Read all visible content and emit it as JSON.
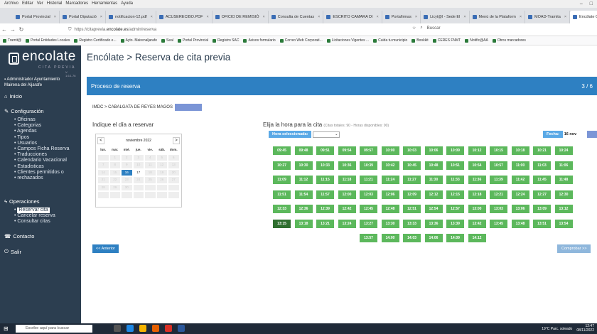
{
  "browser": {
    "menu": [
      "Archivo",
      "Editar",
      "Ver",
      "Historial",
      "Marcadores",
      "Herramientas",
      "Ayuda"
    ],
    "tabs": [
      {
        "label": "Portal Provincial"
      },
      {
        "label": "Portal Diputació"
      },
      {
        "label": "notificacion-12.pdf"
      },
      {
        "label": "ACUSERECIBO.PDF"
      },
      {
        "label": "OFICIO DE REMISIÓ"
      },
      {
        "label": "Consulta de Cuentas"
      },
      {
        "label": "ESCRITO CAMARA DI"
      },
      {
        "label": "Portafirmas"
      },
      {
        "label": "Licyt@l - Sede El"
      },
      {
        "label": "Menú de la Plataform"
      },
      {
        "label": "MOAD-Tramita"
      },
      {
        "label": "Encólate Cita Pre"
      }
    ],
    "url_prefix": "https://citaprevia.",
    "url_domain": "encolate.es",
    "url_path": "/admin/reserva",
    "search_placeholder": "Buscar",
    "bookmarks": [
      "Tramit@",
      "Portal Entidades Locales",
      "Registro Certificado e...",
      "Ayto. Mairenaljarafe",
      "Seal",
      "Portal Provincial",
      "Registro SAC",
      "Avisos formulario",
      "Correo Web Corporati...",
      "Licitaciones Vigentes ...",
      "Cuida tu municipio",
      "Bookkit",
      "CERES FNMT",
      "Notific@AA",
      "Otros marcadores"
    ]
  },
  "sidebar": {
    "logo": "encolate",
    "logo_sub": "CITA PREVIA",
    "version": "V. 1.6.1.76",
    "user_line1": "Administrador Ayuntamiento",
    "user_line2": "Mairena del Aljarafe",
    "inicio": "Inicio",
    "configuracion": "Configuración",
    "config_items": [
      "Oficinas",
      "Categorias",
      "Agendas",
      "Tipos",
      "Usuarios",
      "Campos Ficha Reserva",
      "Traducciones",
      "Calendario Vacacional",
      "Estadisticas",
      "Clientes permitidos o",
      "rechazados"
    ],
    "operaciones": "Operaciones",
    "oper_items": [
      "Reservar cita",
      "Cancelar reserva",
      "Consultar citas"
    ],
    "contacto": "Contacto",
    "salir": "Salir"
  },
  "main": {
    "title": "Encólate > Reserva de cita previa",
    "process": "Proceso de reserva",
    "step": "3 / 6",
    "breadcrumb": "IMDC > CABALGATA DE REYES MAGOS",
    "cal_heading": "Indique el día a reservar",
    "cal_month": "noviembre 2022",
    "cal_prev": "<",
    "cal_next": ">",
    "weekdays": [
      "lun.",
      "mar.",
      "mié.",
      "jue.",
      "vie.",
      "sáb.",
      "dom."
    ],
    "today": "16",
    "active_day": "17",
    "hour_heading": "Elija la hora para la cita",
    "hour_note": "(Citas totales: 90 - Horas disponibles: 90)",
    "hour_selected_label": "Hora seleccionada:",
    "fecha_label": "Fecha:",
    "fecha_value": "16 nov",
    "back": "<< Anterior",
    "next": "Comprobar >>",
    "chosen_slot": "13:15",
    "slot_rows": [
      [
        "09:45",
        "09:48",
        "09:51",
        "09:54",
        "09:57",
        "10:00",
        "10:03",
        "10:06",
        "10:09",
        "10:12",
        "10:15",
        "10:18",
        "10:21",
        "10:24"
      ],
      [
        "10:27",
        "10:30",
        "10:33",
        "10:36",
        "10:39",
        "10:42",
        "10:45",
        "10:48",
        "10:51",
        "10:54",
        "10:57",
        "11:00",
        "11:03",
        "11:06"
      ],
      [
        "11:09",
        "11:12",
        "11:15",
        "11:18",
        "11:21",
        "11:24",
        "11:27",
        "11:30",
        "11:33",
        "11:36",
        "11:39",
        "11:42",
        "11:45",
        "11:48"
      ],
      [
        "11:51",
        "11:54",
        "11:57",
        "12:00",
        "12:03",
        "12:06",
        "12:09",
        "12:12",
        "12:15",
        "12:18",
        "12:21",
        "12:24",
        "12:27",
        "12:30"
      ],
      [
        "12:33",
        "12:36",
        "12:39",
        "12:42",
        "12:45",
        "12:48",
        "12:51",
        "12:54",
        "12:57",
        "13:00",
        "13:03",
        "13:06",
        "13:09",
        "13:12"
      ],
      [
        "13:15",
        "13:18",
        "13:21",
        "13:24",
        "13:27",
        "13:30",
        "13:33",
        "13:36",
        "13:39",
        "13:42",
        "13:45",
        "13:48",
        "13:51",
        "13:54"
      ],
      [
        "13:57",
        "14:00",
        "14:03",
        "14:06",
        "14:09",
        "14:12"
      ]
    ]
  },
  "taskbar": {
    "search": "Escribe aquí para buscar",
    "weather": "19°C Parc. soleado",
    "time": "12:47",
    "date": "08/11/2022"
  }
}
